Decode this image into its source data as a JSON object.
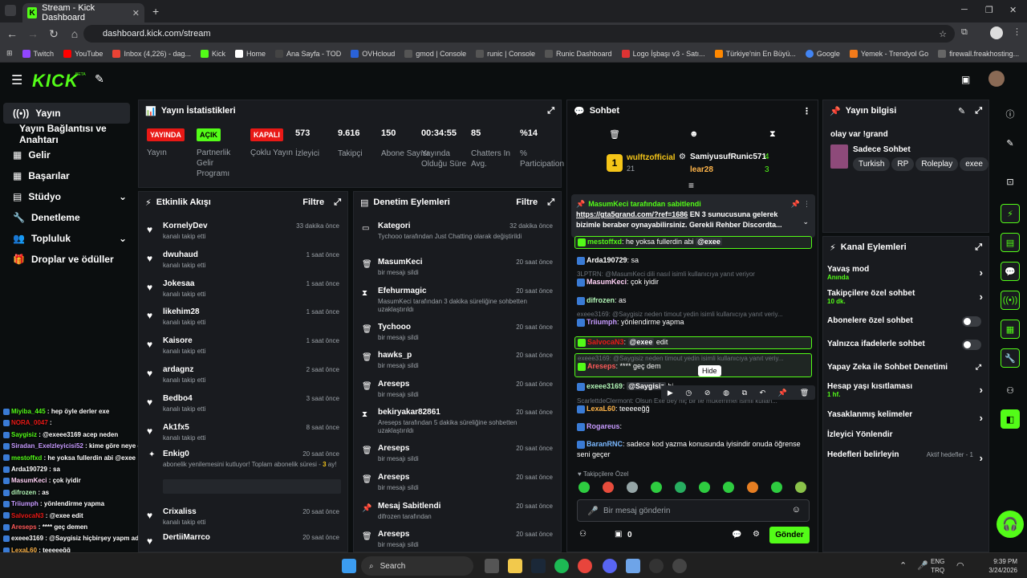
{
  "browser": {
    "tab_title": "Stream - Kick Dashboard",
    "url": "dashboard.kick.com/stream",
    "bookmarks": [
      "Twitch",
      "YouTube",
      "Inbox (4,226) - dag...",
      "Kick",
      "Home",
      "Ana Sayfa - TOD",
      "OVHcloud",
      "gmod | Console",
      "runic | Console",
      "Runic Dashboard",
      "Logo İşbaşı v3 - Satı...",
      "Türkiye'nin En Büyü...",
      "Google",
      "Yemek - Trendyol Go",
      "firewall.freakhosting..."
    ]
  },
  "topnav": {
    "logo": "KICK",
    "beta": "BETA"
  },
  "sidebar": {
    "items": [
      {
        "label": "Yayın",
        "icon": "broadcast-icon"
      },
      {
        "label": "Yayın Bağlantısı ve Anahtarı",
        "icon": ""
      },
      {
        "label": "Gelir",
        "icon": "revenue-icon"
      },
      {
        "label": "Başarılar",
        "icon": "achievements-icon"
      },
      {
        "label": "Stüdyo",
        "icon": "studio-icon"
      },
      {
        "label": "Denetleme",
        "icon": "wrench-icon"
      },
      {
        "label": "Topluluk",
        "icon": "community-icon"
      },
      {
        "label": "Droplar ve ödüller",
        "icon": "gift-icon"
      }
    ]
  },
  "stats": {
    "title": "Yayın İstatistikleri",
    "items": [
      {
        "value": "YAYINDA",
        "label": "Yayın",
        "type": "badge",
        "color": "#e91916"
      },
      {
        "value": "AÇIK",
        "label": "Partnerlik Gelir Programı",
        "type": "badge",
        "color": "#53fc18"
      },
      {
        "value": "KAPALI",
        "label": "Çoklu Yayın",
        "type": "badge",
        "color": "#e91916"
      },
      {
        "value": "573",
        "label": "İzleyici"
      },
      {
        "value": "9.616",
        "label": "Takipçi"
      },
      {
        "value": "150",
        "label": "Abone Sayısı"
      },
      {
        "value": "00:34:55",
        "label": "Yayında Olduğu Süre"
      },
      {
        "value": "85",
        "label": "Chatters In Avg."
      },
      {
        "value": "%14",
        "label": "% Participation"
      }
    ]
  },
  "activity": {
    "title": "Etkinlik Akışı",
    "filter": "Filtre",
    "items": [
      {
        "name": "KornelyDev",
        "sub": "kanalı takip etti",
        "time": "33 dakika önce"
      },
      {
        "name": "dwuhaud",
        "sub": "kanalı takip etti",
        "time": "1 saat önce"
      },
      {
        "name": "Jokesaa",
        "sub": "kanalı takip etti",
        "time": "1 saat önce"
      },
      {
        "name": "likehim28",
        "sub": "kanalı takip etti",
        "time": "1 saat önce"
      },
      {
        "name": "Kaisore",
        "sub": "kanalı takip etti",
        "time": "1 saat önce"
      },
      {
        "name": "ardagnz",
        "sub": "kanalı takip etti",
        "time": "2 saat önce"
      },
      {
        "name": "Bedbo4",
        "sub": "kanalı takip etti",
        "time": "3 saat önce"
      },
      {
        "name": "Ak1fx5",
        "sub": "kanalı takip etti",
        "time": "8 saat önce"
      }
    ],
    "sub_item": {
      "name": "Enkig0",
      "time": "20 saat önce",
      "text": "abonelik yenilemesini kutluyor! Toplam abonelik süresi - ",
      "months": "3",
      "text2": "ay!"
    },
    "items2": [
      {
        "name": "Crixaliss",
        "sub": "kanalı takip etti",
        "time": "20 saat önce"
      },
      {
        "name": "DertiiMarrco",
        "sub": "",
        "time": "20 saat önce"
      }
    ]
  },
  "moderation": {
    "title": "Denetim Eylemleri",
    "filter": "Filtre",
    "items": [
      {
        "name": "Kategori",
        "sub": "Tychooo tarafından Just Chatting olarak değiştirildi",
        "time": "32 dakika önce",
        "icon": "category-icon"
      },
      {
        "name": "MasumKeci",
        "sub": "bir mesajı sildi",
        "time": "20 saat önce",
        "icon": "trash-icon"
      },
      {
        "name": "Efehurmagic",
        "sub": "MasumKeci tarafından 3 dakika süreliğine sohbetten uzaklaştırıldı",
        "time": "20 saat önce",
        "icon": "hourglass-icon"
      },
      {
        "name": "Tychooo",
        "sub": "bir mesajı sildi",
        "time": "20 saat önce",
        "icon": "trash-icon"
      },
      {
        "name": "hawks_p",
        "sub": "bir mesajı sildi",
        "time": "20 saat önce",
        "icon": "trash-icon"
      },
      {
        "name": "Areseps",
        "sub": "bir mesajı sildi",
        "time": "20 saat önce",
        "icon": "trash-icon"
      },
      {
        "name": "bekiryakar82861",
        "sub": "Areseps tarafından 5 dakika süreliğine sohbetten uzaklaştırıldı",
        "time": "20 saat önce",
        "icon": "hourglass-icon"
      },
      {
        "name": "Areseps",
        "sub": "bir mesajı sildi",
        "time": "20 saat önce",
        "icon": "trash-icon"
      },
      {
        "name": "Areseps",
        "sub": "bir mesajı sildi",
        "time": "20 saat önce",
        "icon": "trash-icon"
      },
      {
        "name": "Mesaj Sabitlendi",
        "sub": "difrozen tarafından",
        "time": "20 saat önce",
        "icon": "pin-icon"
      },
      {
        "name": "Areseps",
        "sub": "bir mesajı sildi",
        "time": "20 saat önce",
        "icon": "trash-icon"
      }
    ]
  },
  "chat": {
    "title": "Sohbet",
    "top": [
      {
        "rank": "1",
        "name": "wulftzofficial",
        "count": "21"
      },
      {
        "name": "SamiyusufRunic571",
        "count": "4"
      },
      {
        "name": "lear28",
        "count": "3"
      }
    ],
    "pinned": {
      "by": "MasumKeci tarafından sabitlendi",
      "link": "https://gta5grand.com/?ref=1686",
      "text": " EN 3 sunucusuna gelerek bizimle beraber oynayabilirsiniz. Gerekli Rehber Discordta..."
    },
    "messages": [
      {
        "user": "mestoffxd",
        "text": ": he yoksa fullerdin abi ",
        "mention": "@exee",
        "ucolor": "#53fc18",
        "hl": true
      },
      {
        "user": "Arda190729",
        "text": ": sa",
        "ucolor": "#fff"
      },
      {
        "reply": "3LPTRN: @MasumKeci dili nasıl isimli kullanıcıya yanıt veriyor",
        "user": "MasumKeci",
        "text": ": çok iyidir",
        "ucolor": "#ffd1f6"
      },
      {
        "user": "difrozen",
        "text": ": as",
        "ucolor": "#b3f7b8"
      },
      {
        "reply": "exeee3169: @Saygisiz neden timout yedin isimli kullanıcıya yanıt veriy...",
        "user": "Triiumph",
        "text": ": yönlendirme yapma",
        "ucolor": "#c79bff"
      },
      {
        "user": "SalvocaN3",
        "text": ": ",
        "mention": "@exee",
        "text2": " edit",
        "ucolor": "#e91916",
        "hl": true
      },
      {
        "reply": "exeee3169: @Saygisiz neden timout yedin isimli kullanıcıya yanıt veriy...",
        "user": "Areseps",
        "text": ": **** geç dem",
        "ucolor": "#ff5a5a",
        "hl": true
      },
      {
        "user": "exeee3169",
        "text": ": ",
        "mention": "@Saygisiz",
        "text2": " hi",
        "ucolor": "#b3f7b8"
      },
      {
        "reply": "ScarlettdeClermont: Olsun Exe bey hiç bir ile mükemmel isimli kullan...",
        "user": "LexaL60",
        "text": ": teeeeeğğ",
        "ucolor": "#ffb54a"
      },
      {
        "user": "Rogareus",
        "text": ":",
        "ucolor": "#c79bff"
      },
      {
        "user": "BaranRNC",
        "text": ": sadece kod yazma konusunda iyisindir onuda öğrense seni geçer",
        "ucolor": "#7ab8ff"
      }
    ],
    "tooltip": "Hide",
    "emote_label": "Takipçilere Özel",
    "input_placeholder": "Bir mesaj gönderin",
    "points": "0",
    "send": "Gönder"
  },
  "overlay_chat": [
    {
      "user": "Miyiba_445",
      "text": " : hep öyle derler exe",
      "ucolor": "#53fc18"
    },
    {
      "user": "NORA_0047",
      "text": " :",
      "ucolor": "#e91916"
    },
    {
      "user": "Saygisiz",
      "text": " : @exeee3169 acep neden",
      "ucolor": "#53fc18"
    },
    {
      "user": "Siradan_Exelzleyicisi52",
      "text": " : kime göre neye göre",
      "ucolor": "#c79bff"
    },
    {
      "user": "mestoffxd",
      "text": " : he yoksa fullerdin abi @exee",
      "ucolor": "#53fc18"
    },
    {
      "user": "Arda190729",
      "text": " : sa",
      "ucolor": "#fff"
    },
    {
      "user": "MasumKeci",
      "text": " : çok iyidir",
      "ucolor": "#ffd1f6"
    },
    {
      "user": "difrozen",
      "text": " : as",
      "ucolor": "#b3f7b8"
    },
    {
      "user": "Triiumph",
      "text": " : yönlendirme yapma",
      "ucolor": "#c79bff"
    },
    {
      "user": "SalvocaN3",
      "text": " : @exee edit",
      "ucolor": "#e91916"
    },
    {
      "user": "Areseps",
      "text": " : **** geç demen",
      "ucolor": "#ff5a5a"
    },
    {
      "user": "exeee3169",
      "text": " : @Saygisiz hiçbirşey yapm adım",
      "ucolor": "#fff"
    },
    {
      "user": "LexaL60",
      "text": " : teeeeeğğ",
      "ucolor": "#ffb54a"
    },
    {
      "user": "Rogareus",
      "text": " :",
      "ucolor": "#c79bff"
    },
    {
      "user": "BaranRNC",
      "text": " : sadece kod yazma konusunda iyisindir onuda öğrense seni geçer",
      "ucolor": "#7ab8ff"
    }
  ],
  "stream_info": {
    "title": "Yayın bilgisi",
    "stream_title": "olay var !grand",
    "category": "Sadece Sohbet",
    "tags": [
      "Turkish",
      "RP",
      "Roleplay",
      "exee"
    ]
  },
  "channel_actions": {
    "title": "Kanal Eylemleri",
    "items": [
      {
        "label": "Yavaş mod",
        "sub": "Anında",
        "ctl": "arrow"
      },
      {
        "label": "Takipçilere özel sohbet",
        "sub": "10 dk.",
        "ctl": "arrow"
      },
      {
        "label": "Abonelere özel sohbet",
        "ctl": "toggle"
      },
      {
        "label": "Yalnızca ifadelerle sohbet",
        "ctl": "toggle"
      },
      {
        "label": "Yapay Zeka ile Sohbet Denetimi",
        "ctl": "external"
      },
      {
        "label": "Hesap yaşı kısıtlaması",
        "sub": "1 hf.",
        "ctl": "arrow"
      },
      {
        "label": "Yasaklanmış kelimeler",
        "ctl": "arrow"
      },
      {
        "label": "İzleyici Yönlendir",
        "ctl": "none"
      },
      {
        "label": "Hedefleri belirleyin",
        "sub2": "Aktif hedefler - 1",
        "ctl": "arrow"
      }
    ]
  },
  "taskbar": {
    "search": "Search",
    "lang1": "ENG",
    "lang2": "TRQ",
    "time": "9:39 PM",
    "date": "3/24/2026"
  },
  "colors": {
    "accent": "#53fc18",
    "bg": "#0b0e0f",
    "panel": "#191b1f",
    "danger": "#e91916"
  }
}
